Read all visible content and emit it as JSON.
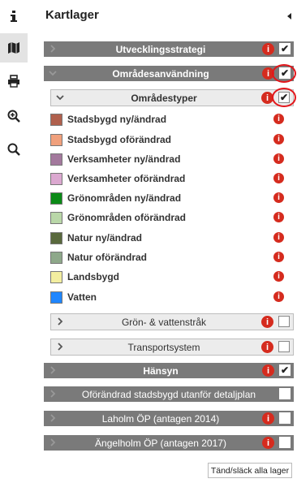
{
  "header": {
    "title": "Kartlager"
  },
  "toolbar": [
    {
      "icon": "info-icon"
    },
    {
      "icon": "map-icon"
    },
    {
      "icon": "print-icon"
    },
    {
      "icon": "zoom-in-icon"
    },
    {
      "icon": "search-icon"
    }
  ],
  "layers": {
    "utvecklingsstrategi": {
      "label": "Utvecklingsstrategi",
      "checked": true
    },
    "omradesanvandning": {
      "label": "Områdesanvändning",
      "checked": true
    },
    "omradestyper": {
      "label": "Områdestyper",
      "checked": true
    },
    "gronvatten": {
      "label": "Grön- & vattenstråk",
      "checked": false
    },
    "transport": {
      "label": "Transportsystem",
      "checked": false
    },
    "hansyn": {
      "label": "Hänsyn",
      "checked": true
    },
    "oforandrad": {
      "label": "Oförändrad stadsbygd utanför detaljplan",
      "checked": false
    },
    "laholm": {
      "label": "Laholm ÖP (antagen 2014)",
      "checked": false
    },
    "angelholm": {
      "label": "Ängelholm ÖP (antagen 2017)",
      "checked": false
    }
  },
  "legend": [
    {
      "label": "Stadsbygd ny/ändrad",
      "color": "#b0604d"
    },
    {
      "label": "Stadsbygd oförändrad",
      "color": "#f0a07c"
    },
    {
      "label": "Verksamheter ny/ändrad",
      "color": "#a3799d"
    },
    {
      "label": "Verksamheter oförändrad",
      "color": "#dba8d0"
    },
    {
      "label": "Grönområden ny/ändrad",
      "color": "#0b8a17"
    },
    {
      "label": "Grönområden oförändrad",
      "color": "#b9d7a8"
    },
    {
      "label": "Natur ny/ändrad",
      "color": "#59693d"
    },
    {
      "label": "Natur oförändrad",
      "color": "#8ea88a"
    },
    {
      "label": "Landsbygd",
      "color": "#f3eea0"
    },
    {
      "label": "Vatten",
      "color": "#1f86ff"
    }
  ],
  "info_glyph": "i",
  "check_glyph": "✔",
  "toggle_all_label": "Tänd/släck alla lager"
}
